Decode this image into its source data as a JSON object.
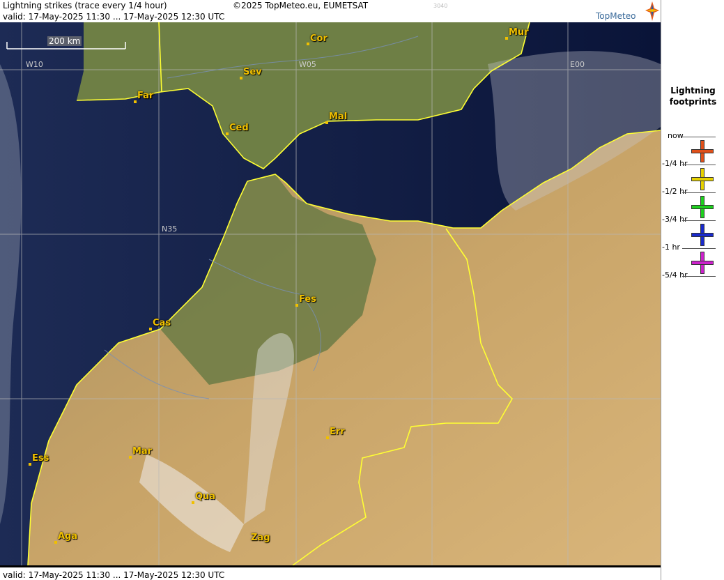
{
  "header": {
    "title": "Lightning strikes (trace every 1/4 hour)",
    "copyright": "©2025 TopMeteo.eu, EUMETSAT",
    "code": "3040",
    "valid": "valid:  17-May-2025 11:30 ... 17-May-2025 12:30 UTC",
    "logo_text": "TopMeteo"
  },
  "footer": {
    "valid": "valid:  17-May-2025 11:30 ... 17-May-2025 12:30 UTC"
  },
  "map": {
    "scale_label": "200 km",
    "grid_labels": {
      "w10": "W10",
      "w05": "W05",
      "e00": "E00",
      "n35": "N35"
    },
    "cities": {
      "cor": "Cor",
      "mur": "Mur",
      "sev": "Sev",
      "far": "Far",
      "mal": "Mal",
      "ced": "Ced",
      "fes": "Fes",
      "cas": "Cas",
      "err": "Err",
      "ess": "Ess",
      "mar": "Mar",
      "qua": "Qua",
      "aga": "Aga",
      "zag": "Zag"
    },
    "colors": {
      "sea": "#0e1a3e",
      "land_green": "#5f7a3c",
      "desert": "#c9a56a",
      "border": "#ffff33",
      "city": "#f0c000"
    }
  },
  "legend": {
    "title_line1": "Lightning",
    "title_line2": "footprints",
    "items": [
      {
        "label": "now",
        "color": ""
      },
      {
        "label": "-1/4 hr",
        "color": "#e0501a"
      },
      {
        "label": "-1/2 hr",
        "color": "#e6d200"
      },
      {
        "label": "-3/4 hr",
        "color": "#1ed01e"
      },
      {
        "label": "-1 hr",
        "color": "#1a2acc"
      },
      {
        "label": "-5/4 hr",
        "color": "#cc22cc"
      }
    ]
  }
}
